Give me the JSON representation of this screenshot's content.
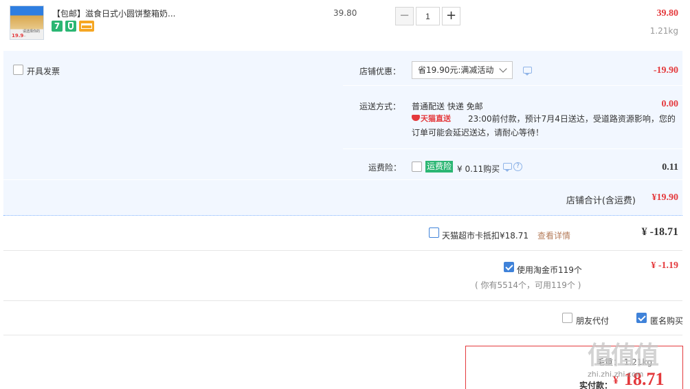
{
  "item": {
    "thumb_price": "19.9",
    "thumb_caption": "请选择你的 ...",
    "title": "【包邮】滋食日式小圆饼整箱奶...",
    "badge_7": "7",
    "unit_price": "39.80",
    "quantity": "1",
    "minus": "−",
    "plus": "+",
    "total": "39.80",
    "weight": "1.21kg"
  },
  "shop": {
    "invoice_label": "开具发票",
    "discount_label": "店铺优惠：",
    "discount_value": "省19.90元:满减活动",
    "discount_amount": "-19.90",
    "shipping_label": "运送方式：",
    "shipping_method": "普通配送 快递 免邮",
    "shipping_amount": "0.00",
    "tmall_direct": "天猫直送",
    "shipping_note_1": "23:00前付款，预计7月4日送达，受道路资源影响，您的",
    "shipping_note_2": "订单可能会延迟送达，请耐心等待！",
    "insurance_label": "运费险：",
    "insurance_badge": "运费险",
    "insurance_price": "¥ 0.11购买",
    "insurance_q": "?",
    "insurance_amount": "0.11",
    "store_total_label": "店铺合计(含运费)",
    "store_total_amount": "¥19.90"
  },
  "card": {
    "label": "天猫超市卡抵扣¥18.71",
    "link": "查看详情",
    "amount": "¥ -18.71"
  },
  "coins": {
    "label": "使用淘金币119个",
    "note": "( 你有5514个，可用119个 )",
    "amount": "¥ -1.19"
  },
  "options": {
    "friend_pay": "朋友代付",
    "anonymous": "匿名购买"
  },
  "pay": {
    "weight": "毛重：  1.21kg",
    "label": "实付款：",
    "symbol": "¥",
    "amount": "18.71"
  },
  "watermark": {
    "big": "值值值",
    "small": "zhi.zhi.zhi.com"
  }
}
